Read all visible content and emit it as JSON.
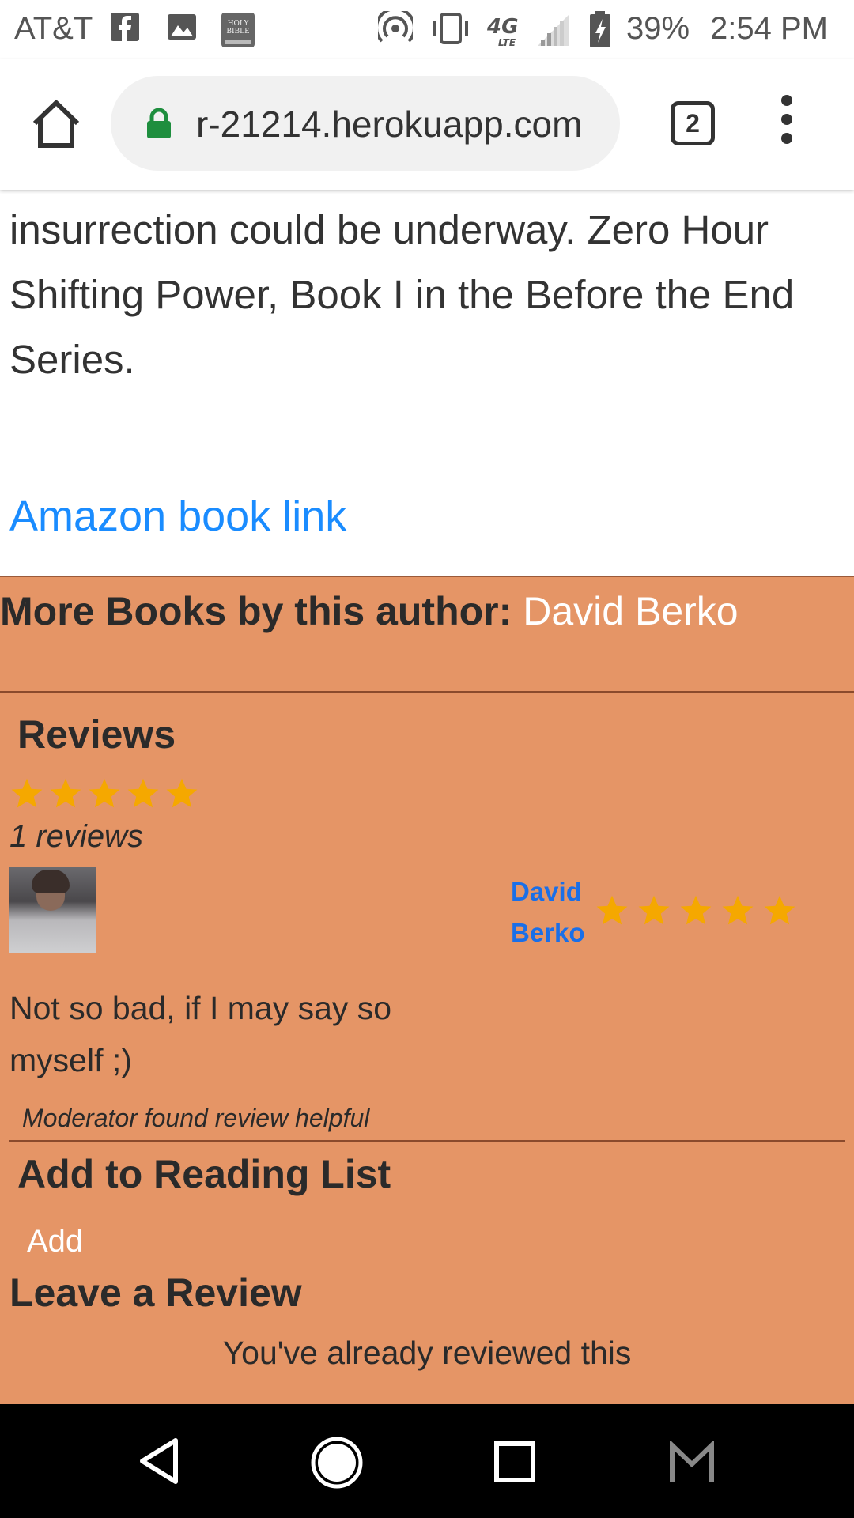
{
  "status_bar": {
    "carrier": "AT&T",
    "battery": "39%",
    "time": "2:54 PM",
    "icons": [
      "facebook-icon",
      "image-icon",
      "bible-icon",
      "hotspot-icon",
      "vibrate-icon",
      "4g-lte-icon",
      "signal-icon",
      "battery-charging-icon"
    ]
  },
  "browser": {
    "url": "r-21214.herokuapp.com",
    "tab_count": "2"
  },
  "content": {
    "description": "insurrection could be underway. Zero Hour Shifting Power, Book I in the Before the End Series.",
    "amazon_link": "Amazon book link"
  },
  "more_books": {
    "label": "More Books by this author:",
    "author": "David Berko"
  },
  "reviews": {
    "title": "Reviews",
    "rating": 5,
    "count_text": "1 reviews",
    "items": [
      {
        "reviewer": "David Berko",
        "rating": 5,
        "text": "Not so bad, if I may say so myself ;)",
        "helpful_note": "Moderator found review helpful"
      }
    ]
  },
  "reading_list": {
    "title": "Add to Reading List",
    "add_label": "Add"
  },
  "leave_review": {
    "title": "Leave a Review",
    "message": "You've already reviewed this"
  },
  "colors": {
    "section_bg": "#e59566",
    "link": "#1a8cff",
    "star": "#f5a800"
  }
}
